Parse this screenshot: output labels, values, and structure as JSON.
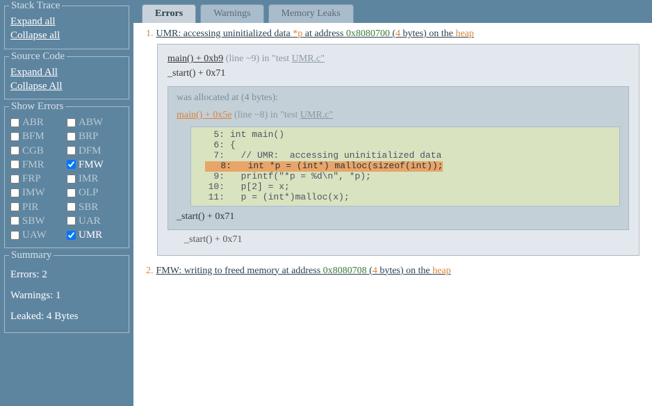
{
  "sidebar": {
    "stackTrace": {
      "legend": "Stack Trace",
      "expand": "Expand all",
      "collapse": "Collapse all"
    },
    "sourceCode": {
      "legend": "Source Code",
      "expand": "Expand All",
      "collapse": "Collapse All"
    },
    "showErrors": {
      "legend": "Show Errors",
      "items": [
        {
          "code": "ABR",
          "checked": false
        },
        {
          "code": "ABW",
          "checked": false
        },
        {
          "code": "BFM",
          "checked": false
        },
        {
          "code": "BRP",
          "checked": false
        },
        {
          "code": "CGB",
          "checked": false
        },
        {
          "code": "DFM",
          "checked": false
        },
        {
          "code": "FMR",
          "checked": false
        },
        {
          "code": "FMW",
          "checked": true
        },
        {
          "code": "FRP",
          "checked": false
        },
        {
          "code": "IMR",
          "checked": false
        },
        {
          "code": "IMW",
          "checked": false
        },
        {
          "code": "OLP",
          "checked": false
        },
        {
          "code": "PIR",
          "checked": false
        },
        {
          "code": "SBR",
          "checked": false
        },
        {
          "code": "SBW",
          "checked": false
        },
        {
          "code": "UAR",
          "checked": false
        },
        {
          "code": "UAW",
          "checked": false
        },
        {
          "code": "UMR",
          "checked": true
        }
      ]
    },
    "summary": {
      "legend": "Summary",
      "errors": "Errors: 2",
      "warnings": "Warnings: 1",
      "leaked": "Leaked: 4 Bytes"
    }
  },
  "tabs": {
    "errors": "Errors",
    "warnings": "Warnings",
    "leaks": "Memory Leaks"
  },
  "errors": [
    {
      "num": "1.",
      "title": {
        "pre": "UMR: accessing uninitialized data ",
        "var": "*p",
        "mid1": " at address ",
        "addr": "0x8080700",
        "mid2": " (",
        "bytes": "4",
        "mid3": " bytes) on the ",
        "heap": "heap"
      },
      "trace": {
        "func": "main() + 0xb9",
        "loc": " (line ~9) in \"test  ",
        "file": "UMR.c\"",
        "start": "_start() + 0x71"
      },
      "alloc": {
        "title": "was allocated at (4 bytes):",
        "func": "main() + 0x5e",
        "loc": " (line ~8) in \"test  ",
        "file": "UMR.c\"",
        "code": [
          {
            "n": "5:",
            "t": "int main()",
            "hl": false
          },
          {
            "n": "6:",
            "t": "{",
            "hl": false
          },
          {
            "n": "7:",
            "t": "  // UMR:  accessing uninitialized data",
            "hl": false
          },
          {
            "n": "8:",
            "t": "  int *p = (int*) malloc(sizeof(int));",
            "hl": true
          },
          {
            "n": "9:",
            "t": "  printf(\"*p = %d\\n\", *p);",
            "hl": false
          },
          {
            "n": "10:",
            "t": "  p[2] = x;",
            "hl": false
          },
          {
            "n": "11:",
            "t": "  p = (int*)malloc(x);",
            "hl": false
          }
        ],
        "start": "_start() + 0x71"
      }
    },
    {
      "num": "2.",
      "title": {
        "pre": "FMW: writing to freed memory at address ",
        "var": "",
        "mid1": "",
        "addr": "0x8080708",
        "mid2": " (",
        "bytes": "4",
        "mid3": " bytes) on the ",
        "heap": "heap"
      }
    }
  ]
}
